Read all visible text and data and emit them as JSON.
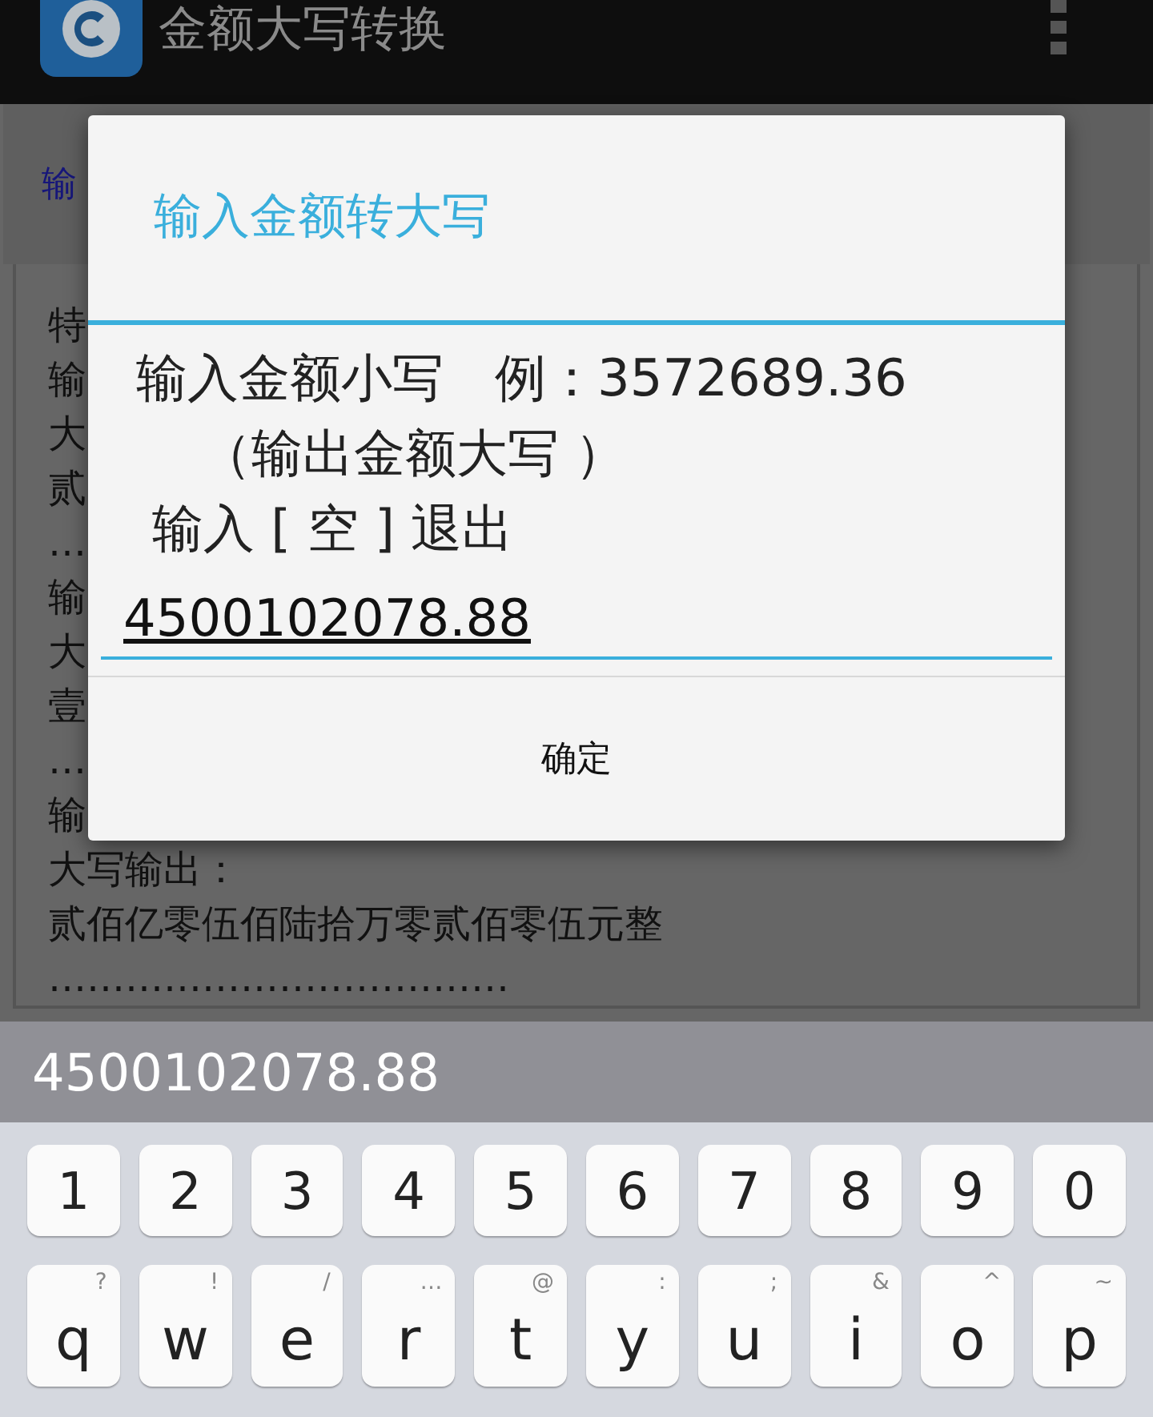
{
  "app_bar": {
    "title": "金额大写转换"
  },
  "background": {
    "tab_label": "输",
    "lines": [
      "特",
      "输",
      "大",
      "贰",
      "……",
      "输",
      "大",
      "壹",
      "……",
      "输",
      "大写输出：",
      "贰佰亿零伍佰陆拾万零贰佰零伍元整",
      "………………………………"
    ]
  },
  "dialog": {
    "title": "输入金额转大写",
    "message": [
      "输入金额小写　例：3572689.36",
      "（输出金额大写 ）",
      "输入 [ 空 ] 退出"
    ],
    "value": "4500102078.88",
    "button": "确定"
  },
  "keyboard": {
    "suggestion": "4500102078.88",
    "number_row": [
      "1",
      "2",
      "3",
      "4",
      "5",
      "6",
      "7",
      "8",
      "9",
      "0"
    ],
    "letter_row": [
      {
        "label": "q",
        "hint": "?"
      },
      {
        "label": "w",
        "hint": "!"
      },
      {
        "label": "e",
        "hint": "/"
      },
      {
        "label": "r",
        "hint": "…"
      },
      {
        "label": "t",
        "hint": "@"
      },
      {
        "label": "y",
        "hint": ":"
      },
      {
        "label": "u",
        "hint": ";"
      },
      {
        "label": "i",
        "hint": "&"
      },
      {
        "label": "o",
        "hint": "^"
      },
      {
        "label": "p",
        "hint": "~"
      }
    ]
  }
}
